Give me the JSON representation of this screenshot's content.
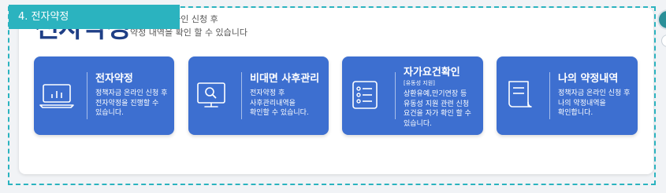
{
  "section": {
    "tab_label": "4. 전자약정"
  },
  "header": {
    "title": "전자약정",
    "subtitle_1": "정책자금 온라인 신청 후",
    "subtitle_2": "약정 내역을 확인 할 수 있습니다"
  },
  "cards": [
    {
      "icon": "laptop-chart-icon",
      "title": "전자약정",
      "tag": "",
      "desc": [
        "정책자금 온라인 신청 후",
        "전자약정을 진행할 수",
        "있습니다."
      ]
    },
    {
      "icon": "monitor-search-icon",
      "title": "비대면 사후관리",
      "tag": "",
      "desc": [
        "전자약정 후",
        "사후관리내역을",
        "확인할 수 있습니다."
      ]
    },
    {
      "icon": "checklist-icon",
      "title": "자가요건확인",
      "tag": "[유동성 지원]",
      "desc": [
        "상환유예,만기연장 등",
        "유동성 지원 관련 신청",
        "요건을 자가 확인 할 수",
        "있습니다."
      ]
    },
    {
      "icon": "document-icon",
      "title": "나의 약정내역",
      "tag": "",
      "desc": [
        "정책자금 온라인 신청 후",
        "나의 약정내역을",
        "확인합니다."
      ]
    }
  ],
  "colors": {
    "accent": "#2bb3bf",
    "card": "#3d6fd0",
    "title": "#1f3f86"
  }
}
